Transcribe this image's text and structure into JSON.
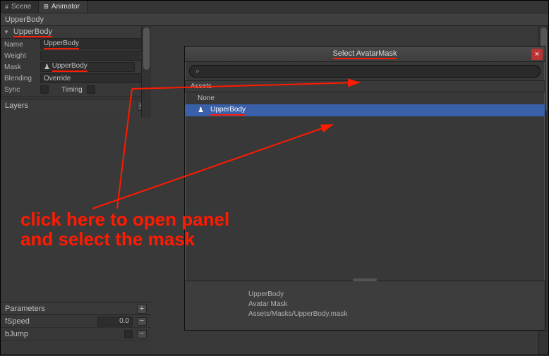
{
  "tabs": {
    "scene": "Scene",
    "animator": "Animator"
  },
  "sub_header": "UpperBody",
  "layer": {
    "title": "UpperBody",
    "name_label": "Name",
    "name_value": "UpperBody",
    "weight_label": "Weight",
    "weight_value": "1",
    "mask_label": "Mask",
    "mask_value": "UpperBody",
    "blending_label": "Blending",
    "blending_value": "Override",
    "sync_label": "Sync",
    "timing_label": "Timing",
    "layers_label": "Layers"
  },
  "params": {
    "header": "Parameters",
    "items": [
      {
        "name": "fSpeed",
        "value": "0.0"
      },
      {
        "name": "bJump",
        "value": ""
      }
    ]
  },
  "popup": {
    "title": "Select AvatarMask",
    "search_placeholder": "",
    "assets_tab": "Assets",
    "items": [
      {
        "label": "None",
        "selected": false
      },
      {
        "label": "UpperBody",
        "selected": true
      }
    ],
    "footer": {
      "name": "UpperBody",
      "type": "Avatar Mask",
      "path": "Assets/Masks/UpperBody.mask"
    }
  },
  "annotation": {
    "line1": "click here to open panel",
    "line2": "and select the mask"
  },
  "icons": {
    "grid": "#",
    "animator": "⊞",
    "search": "⌕",
    "mask": "♟"
  }
}
